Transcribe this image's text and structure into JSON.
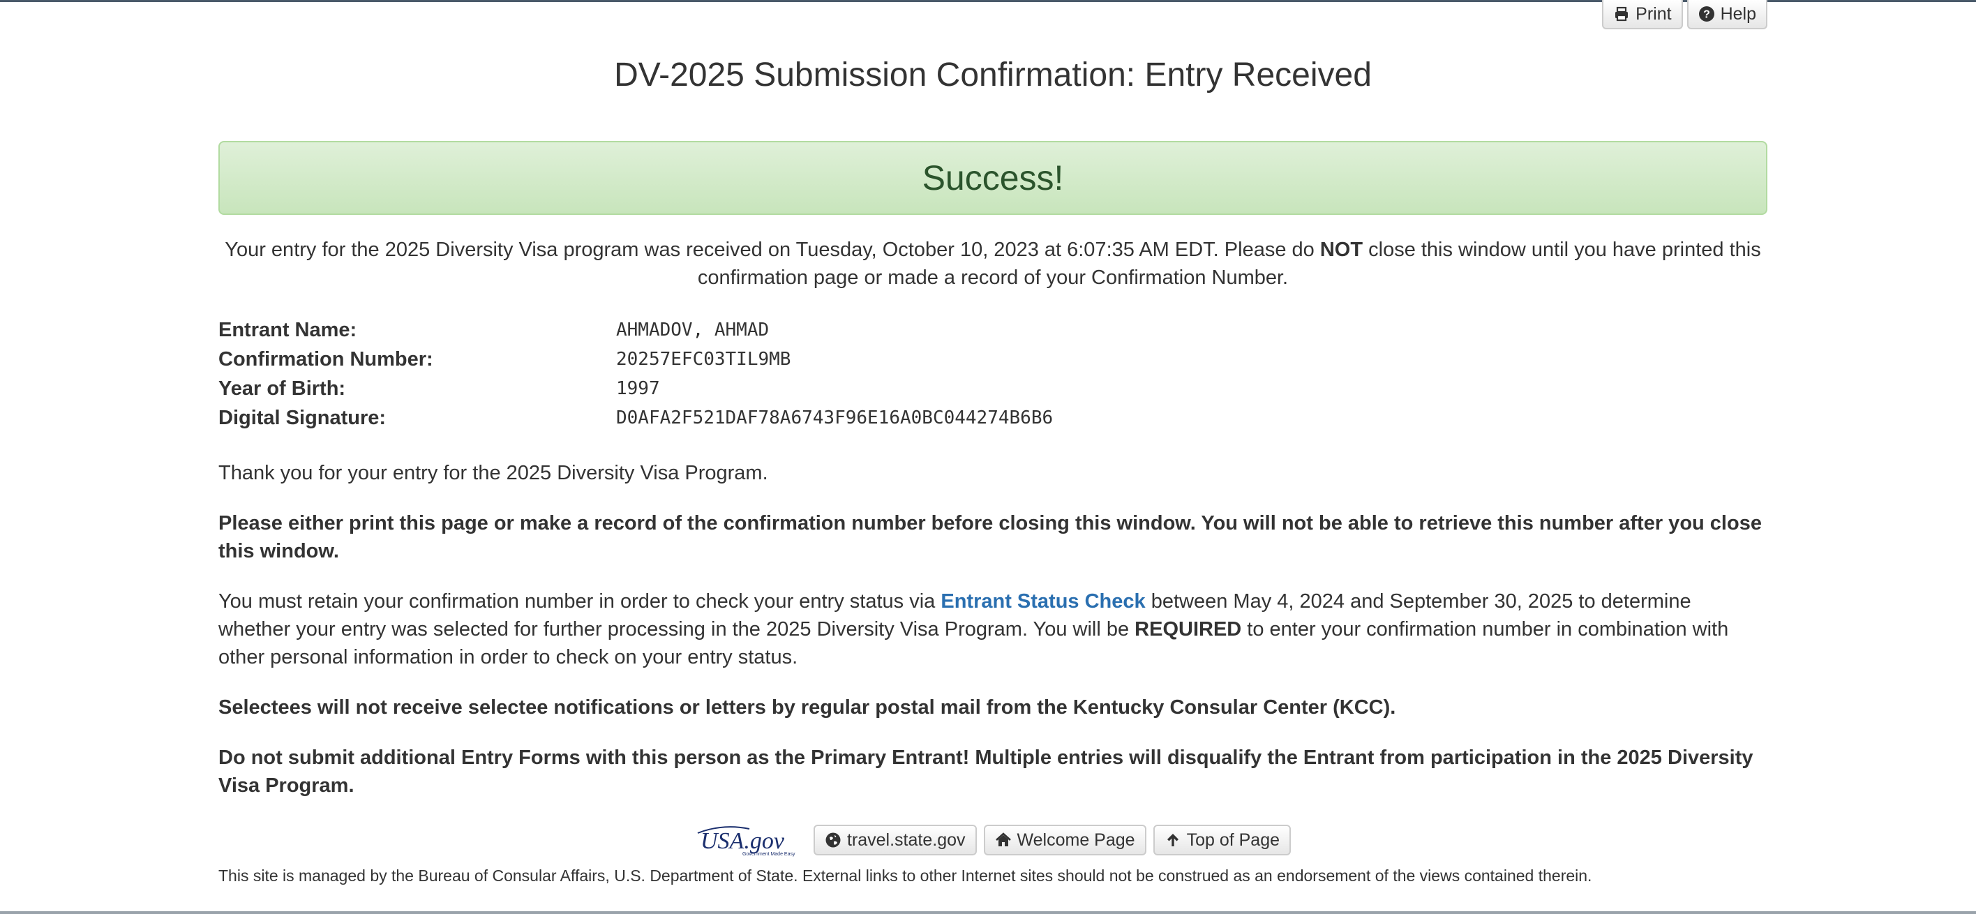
{
  "header": {
    "print_label": "Print",
    "help_label": "Help"
  },
  "page": {
    "title": "DV-2025 Submission Confirmation: Entry Received",
    "alert": "Success!"
  },
  "intro": {
    "part1": "Your entry for the 2025 Diversity Visa program was received on Tuesday, October 10, 2023 at 6:07:35 AM EDT. Please do ",
    "emphasis": "NOT",
    "part2": " close this window until you have printed this confirmation page or made a record of your Confirmation Number."
  },
  "details": [
    {
      "label": "Entrant Name:",
      "value": "AHMADOV, AHMAD"
    },
    {
      "label": "Confirmation Number:",
      "value": "20257EFC03TIL9MB"
    },
    {
      "label": "Year of Birth:",
      "value": "1997"
    },
    {
      "label": "Digital Signature:",
      "value": "D0AFA2F521DAF78A6743F96E16A0BC044274B6B6"
    }
  ],
  "body": {
    "thanks": "Thank you for your entry for the 2025 Diversity Visa Program.",
    "print_warning": "Please either print this page or make a record of the confirmation number before closing this window. You will not be able to retrieve this number after you close this window.",
    "retain_part1": "You must retain your confirmation number in order to check your entry status via ",
    "status_link": "Entrant Status Check",
    "retain_part2": " between May 4, 2024 and September 30, 2025 to determine whether your entry was selected for further processing in the 2025 Diversity Visa Program. You will be ",
    "required": "REQUIRED",
    "retain_part3": " to enter your confirmation number in combination with other personal information in order to check on your entry status.",
    "selectees": "Selectees will not receive selectee notifications or letters by regular postal mail from the Kentucky Consular Center (KCC).",
    "multiple": "Do not submit additional Entry Forms with this person as the Primary Entrant! Multiple entries will disqualify the Entrant from participation in the 2025 Diversity Visa Program."
  },
  "footer": {
    "usagov_text": "USA.gov",
    "usagov_tagline": "Government Made Easy",
    "travel_label": "travel.state.gov",
    "welcome_label": "Welcome Page",
    "top_label": "Top of Page",
    "disclaimer": "This site is managed by the Bureau of Consular Affairs, U.S. Department of State. External links to other Internet sites should not be construed as an endorsement of the views contained therein."
  },
  "colors": {
    "link": "#2a6fb0",
    "success_text": "#2b542c",
    "success_bg": "#dff0d8",
    "usagov_blue": "#1b2f6e",
    "usagov_red": "#c8102e"
  },
  "icons": [
    "print-icon",
    "help-icon",
    "globe-icon",
    "home-icon",
    "arrow-up-icon"
  ]
}
